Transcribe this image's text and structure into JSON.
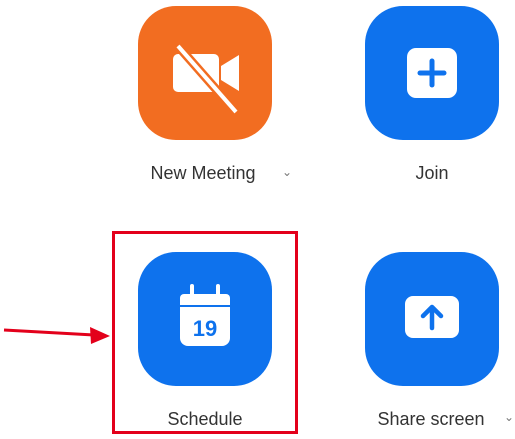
{
  "actions": [
    {
      "key": "new_meeting",
      "label": "New Meeting",
      "icon": "video-off-icon",
      "color": "#f26d21",
      "has_dropdown": true
    },
    {
      "key": "join",
      "label": "Join",
      "icon": "plus-icon",
      "color": "#0e72ed",
      "has_dropdown": false
    },
    {
      "key": "schedule",
      "label": "Schedule",
      "icon": "calendar-icon",
      "color": "#0e72ed",
      "has_dropdown": false,
      "calendar_day": "19"
    },
    {
      "key": "share_screen",
      "label": "Share screen",
      "icon": "share-up-arrow-icon",
      "color": "#0e72ed",
      "has_dropdown": true
    }
  ],
  "annotation": {
    "highlight_color": "#e3001b",
    "highlight_target": "schedule",
    "pointer": "red-arrow"
  },
  "chevron_glyph": "⌄"
}
